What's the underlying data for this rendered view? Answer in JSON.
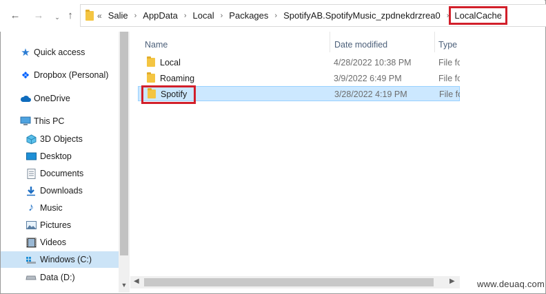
{
  "nav": {
    "back_icon": "back-arrow-icon",
    "forward_icon": "forward-arrow-icon",
    "recent_icon": "chevron-down-icon",
    "up_icon": "up-arrow-icon"
  },
  "address": {
    "overflow": "«",
    "crumbs": [
      "Salie",
      "AppData",
      "Local",
      "Packages",
      "SpotifyAB.SpotifyMusic_zpdnekdrzrea0",
      "LocalCache"
    ],
    "separator": "›"
  },
  "sidebar": {
    "items": [
      {
        "label": "Quick access",
        "icon": "star-icon"
      },
      {
        "label": "Dropbox (Personal)",
        "icon": "dropbox-icon"
      },
      {
        "label": "OneDrive",
        "icon": "cloud-icon"
      },
      {
        "label": "This PC",
        "icon": "computer-icon"
      },
      {
        "label": "3D Objects",
        "icon": "3d-objects-icon"
      },
      {
        "label": "Desktop",
        "icon": "desktop-icon"
      },
      {
        "label": "Documents",
        "icon": "documents-icon"
      },
      {
        "label": "Downloads",
        "icon": "download-icon"
      },
      {
        "label": "Music",
        "icon": "music-icon"
      },
      {
        "label": "Pictures",
        "icon": "pictures-icon"
      },
      {
        "label": "Videos",
        "icon": "videos-icon"
      },
      {
        "label": "Windows (C:)",
        "icon": "drive-icon"
      },
      {
        "label": "Data (D:)",
        "icon": "drive-icon"
      }
    ]
  },
  "columns": {
    "name": "Name",
    "date": "Date modified",
    "type": "Type"
  },
  "files": [
    {
      "name": "Local",
      "date": "4/28/2022 10:38 PM",
      "type": "File fo"
    },
    {
      "name": "Roaming",
      "date": "3/9/2022 6:49 PM",
      "type": "File fo"
    },
    {
      "name": "Spotify",
      "date": "3/28/2022 4:19 PM",
      "type": "File fo"
    }
  ],
  "colors": {
    "highlight": "#d21f2a",
    "selection": "#cce8ff"
  },
  "watermark": "www.deuaq.com"
}
